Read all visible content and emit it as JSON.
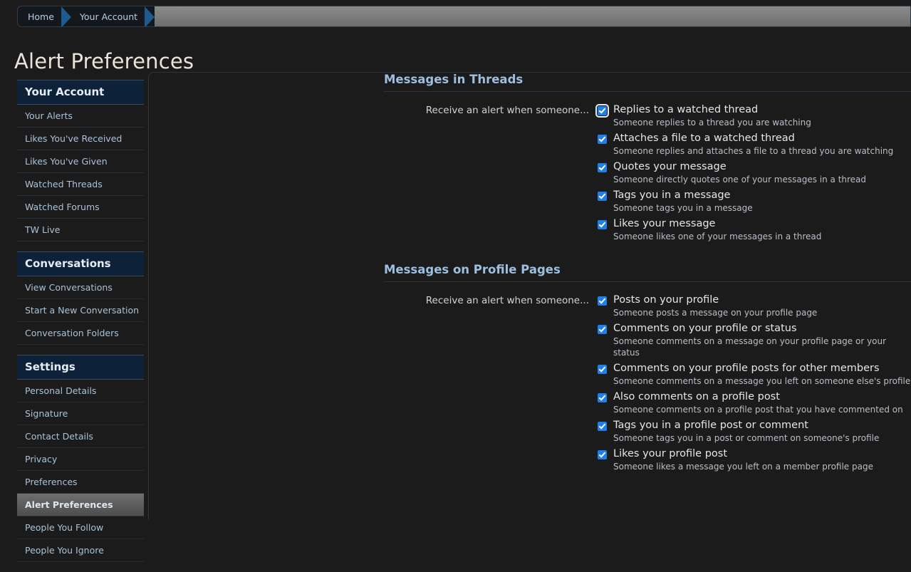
{
  "breadcrumb": {
    "items": [
      {
        "label": "Home"
      },
      {
        "label": "Your Account"
      }
    ]
  },
  "page_title": "Alert Preferences",
  "sidebar": {
    "blocks": [
      {
        "heading": "Your Account",
        "items": [
          {
            "label": "Your Alerts",
            "active": false
          },
          {
            "label": "Likes You've Received",
            "active": false
          },
          {
            "label": "Likes You've Given",
            "active": false
          },
          {
            "label": "Watched Threads",
            "active": false
          },
          {
            "label": "Watched Forums",
            "active": false
          },
          {
            "label": "TW Live",
            "active": false
          }
        ]
      },
      {
        "heading": "Conversations",
        "items": [
          {
            "label": "View Conversations",
            "active": false
          },
          {
            "label": "Start a New Conversation",
            "active": false
          },
          {
            "label": "Conversation Folders",
            "active": false
          }
        ]
      },
      {
        "heading": "Settings",
        "items": [
          {
            "label": "Personal Details",
            "active": false
          },
          {
            "label": "Signature",
            "active": false
          },
          {
            "label": "Contact Details",
            "active": false
          },
          {
            "label": "Privacy",
            "active": false
          },
          {
            "label": "Preferences",
            "active": false
          },
          {
            "label": "Alert Preferences",
            "active": true
          },
          {
            "label": "People You Follow",
            "active": false
          },
          {
            "label": "People You Ignore",
            "active": false
          }
        ]
      }
    ]
  },
  "main": {
    "sections": [
      {
        "title": "Messages in Threads",
        "row_label": "Receive an alert when someone...",
        "options": [
          {
            "label": "Replies to a watched thread",
            "description": "Someone replies to a thread you are watching",
            "checked": true,
            "focused": true
          },
          {
            "label": "Attaches a file to a watched thread",
            "description": "Someone replies and attaches a file to a thread you are watching",
            "checked": true,
            "focused": false
          },
          {
            "label": "Quotes your message",
            "description": "Someone directly quotes one of your messages in a thread",
            "checked": true,
            "focused": false
          },
          {
            "label": "Tags you in a message",
            "description": "Someone tags you in a message",
            "checked": true,
            "focused": false
          },
          {
            "label": "Likes your message",
            "description": "Someone likes one of your messages in a thread",
            "checked": true,
            "focused": false
          }
        ]
      },
      {
        "title": "Messages on Profile Pages",
        "row_label": "Receive an alert when someone...",
        "options": [
          {
            "label": "Posts on your profile",
            "description": "Someone posts a message on your profile page",
            "checked": true,
            "focused": false
          },
          {
            "label": "Comments on your profile or status",
            "description": "Someone comments on a message on your profile page or your status",
            "checked": true,
            "focused": false
          },
          {
            "label": "Comments on your profile posts for other members",
            "description": "Someone comments on a message you left on someone else's profile",
            "checked": true,
            "focused": false
          },
          {
            "label": "Also comments on a profile post",
            "description": "Someone comments on a profile post that you have commented on",
            "checked": true,
            "focused": false
          },
          {
            "label": "Tags you in a profile post or comment",
            "description": "Someone tags you in a post or comment on someone's profile",
            "checked": true,
            "focused": false
          },
          {
            "label": "Likes your profile post",
            "description": "Someone likes a message you left on a member profile page",
            "checked": true,
            "focused": false
          }
        ]
      }
    ]
  },
  "colors": {
    "accent_blue": "#1f7fea",
    "heading_blue": "#9ebfdf",
    "sidebar_head_bg": "#0d2238",
    "page_bg": "#1b1b1b",
    "crumb_arrow": "#1d5b8f"
  }
}
